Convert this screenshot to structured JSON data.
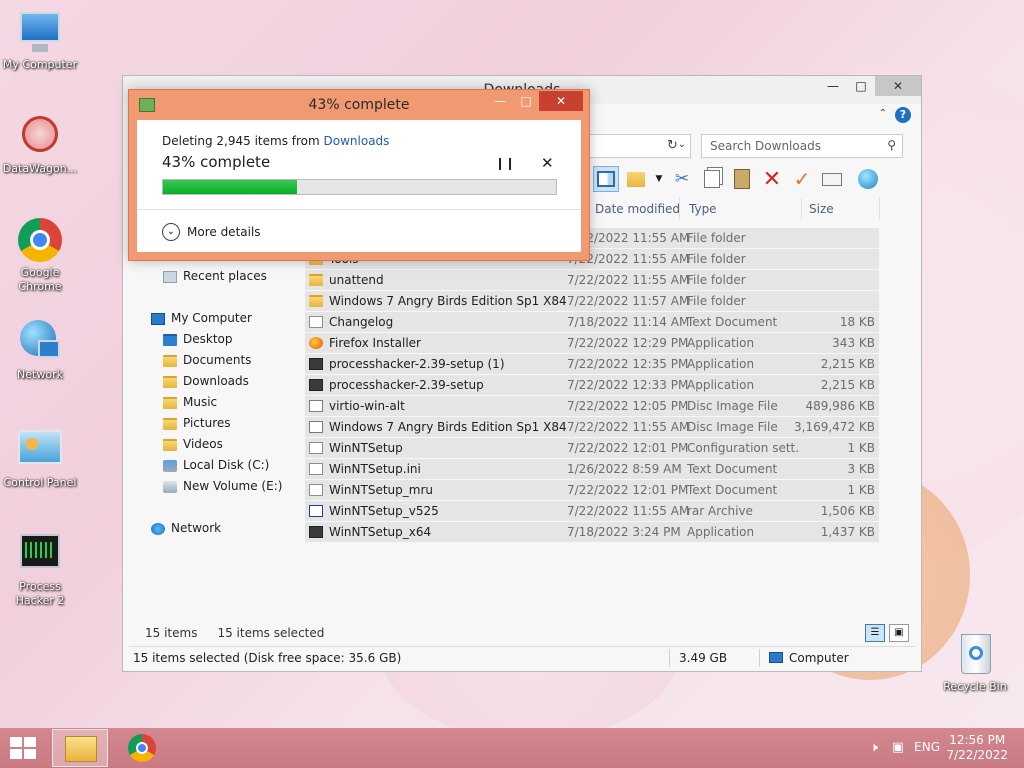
{
  "desktop": {
    "icons": [
      {
        "label": "My Computer"
      },
      {
        "label": "DataWagon..."
      },
      {
        "label": "Google Chrome"
      },
      {
        "label": "Network"
      },
      {
        "label": "Control Panel"
      },
      {
        "label": "Process Hacker 2"
      },
      {
        "label": "Recycle Bin"
      }
    ]
  },
  "explorer": {
    "title": "Downloads",
    "search_placeholder": "Search Downloads",
    "columns": {
      "date": "Date modified",
      "type": "Type",
      "size": "Size"
    },
    "nav": {
      "recent": "Recent places",
      "computer": "My Computer",
      "desktop": "Desktop",
      "documents": "Documents",
      "downloads": "Downloads",
      "music": "Music",
      "pictures": "Pictures",
      "videos": "Videos",
      "local_disk": "Local Disk (C:)",
      "new_volume": "New Volume (E:)",
      "network": "Network"
    },
    "files": [
      {
        "name": "Tools",
        "date": "7/22/2022 11:55 AM",
        "type": "File folder",
        "size": "",
        "icon": "folder"
      },
      {
        "name": "Tools",
        "date": "7/22/2022 11:55 AM",
        "type": "File folder",
        "size": "",
        "icon": "folder"
      },
      {
        "name": "unattend",
        "date": "7/22/2022 11:55 AM",
        "type": "File folder",
        "size": "",
        "icon": "folder"
      },
      {
        "name": "Windows 7 Angry Birds Edition Sp1 X84",
        "date": "7/22/2022 11:57 AM",
        "type": "File folder",
        "size": "",
        "icon": "folder"
      },
      {
        "name": "Changelog",
        "date": "7/18/2022 11:14 AM",
        "type": "Text Document",
        "size": "18 KB",
        "icon": "doc"
      },
      {
        "name": "Firefox Installer",
        "date": "7/22/2022 12:29 PM",
        "type": "Application",
        "size": "343 KB",
        "icon": "firefox"
      },
      {
        "name": "processhacker-2.39-setup (1)",
        "date": "7/22/2022 12:35 PM",
        "type": "Application",
        "size": "2,215 KB",
        "icon": "app"
      },
      {
        "name": "processhacker-2.39-setup",
        "date": "7/22/2022 12:33 PM",
        "type": "Application",
        "size": "2,215 KB",
        "icon": "app"
      },
      {
        "name": "virtio-win-alt",
        "date": "7/22/2022 12:05 PM",
        "type": "Disc Image File",
        "size": "489,986 KB",
        "icon": "disc"
      },
      {
        "name": "Windows 7 Angry Birds Edition Sp1 X84",
        "date": "7/22/2022 11:55 AM",
        "type": "Disc Image File",
        "size": "3,169,472 KB",
        "icon": "disc"
      },
      {
        "name": "WinNTSetup",
        "date": "7/22/2022 12:01 PM",
        "type": "Configuration sett...",
        "size": "1 KB",
        "icon": "cfg"
      },
      {
        "name": "WinNTSetup.ini",
        "date": "1/26/2022 8:59 AM",
        "type": "Text Document",
        "size": "3 KB",
        "icon": "doc"
      },
      {
        "name": "WinNTSetup_mru",
        "date": "7/22/2022 12:01 PM",
        "type": "Text Document",
        "size": "1 KB",
        "icon": "doc"
      },
      {
        "name": "WinNTSetup_v525",
        "date": "7/22/2022 11:55 AM",
        "type": "rar Archive",
        "size": "1,506 KB",
        "icon": "rar"
      },
      {
        "name": "WinNTSetup_x64",
        "date": "7/18/2022 3:24 PM",
        "type": "Application",
        "size": "1,437 KB",
        "icon": "app"
      }
    ],
    "items_count": "15 items",
    "items_selected": "15 items selected",
    "status_left": "15 items selected (Disk free space: 35.6 GB)",
    "status_size": "3.49 GB",
    "status_location": "Computer"
  },
  "dialog": {
    "title": "43% complete",
    "line_prefix": "Deleting 2,945 items from ",
    "line_link": "Downloads",
    "percent_text": "43% complete",
    "progress": 0.34,
    "more_details": "More details"
  },
  "taskbar": {
    "lang": "ENG",
    "time": "12:56 PM",
    "date": "7/22/2022"
  }
}
